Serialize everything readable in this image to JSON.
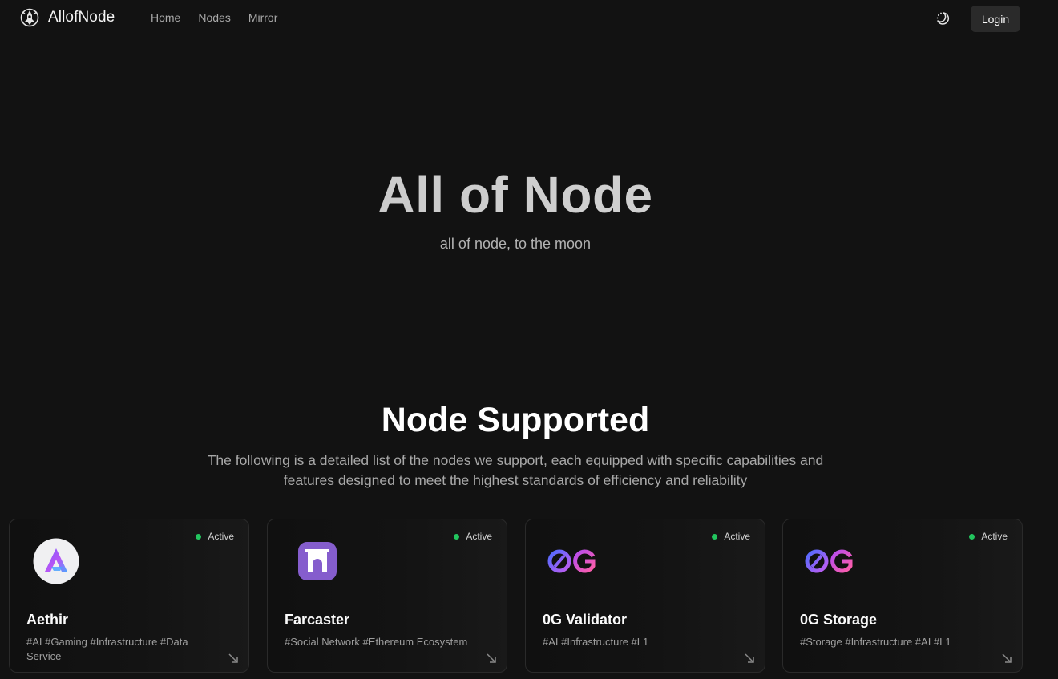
{
  "nav": {
    "brand": "AllofNode",
    "links": [
      "Home",
      "Nodes",
      "Mirror"
    ],
    "theme_icon": "moon-sun-toggle-icon",
    "login_label": "Login"
  },
  "hero": {
    "title": "All of Node",
    "subtitle": "all of node, to the moon"
  },
  "section": {
    "title": "Node Supported",
    "description": "The following is a detailed list of the nodes we support, each equipped with specific capabilities and features designed to meet the highest standards of efficiency and reliability"
  },
  "cards": [
    {
      "name": "Aethir",
      "tags": "#AI #Gaming #Infrastructure #Data Service",
      "status": "Active",
      "logo": "aethir-logo"
    },
    {
      "name": "Farcaster",
      "tags": "#Social Network #Ethereum Ecosystem",
      "status": "Active",
      "logo": "farcaster-logo"
    },
    {
      "name": "0G Validator",
      "tags": "#AI #Infrastructure #L1",
      "status": "Active",
      "logo": "0g-logo"
    },
    {
      "name": "0G Storage",
      "tags": "#Storage #Infrastructure #AI #L1",
      "status": "Active",
      "logo": "0g-logo"
    }
  ],
  "colors": {
    "background": "#121212",
    "active_status": "#22c55e",
    "muted_text": "#a8a8a8"
  }
}
